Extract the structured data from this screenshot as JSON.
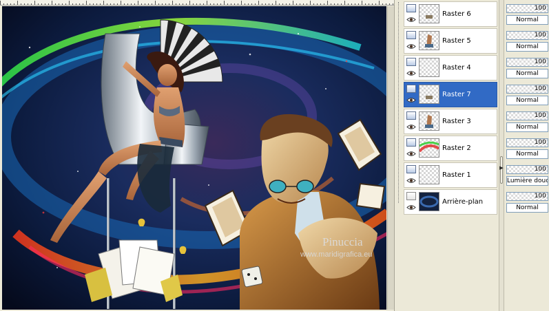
{
  "canvas": {
    "watermark_name": "Pinuccia",
    "watermark_url": "www.maridigrafica.eu"
  },
  "layers": [
    {
      "name": "Raster 6",
      "opacity": "100",
      "opacity_level": 1.0,
      "blend": "Normal",
      "selected": false,
      "type_icon": "raster-layer-icon",
      "thumb": "transparent-with-small-object"
    },
    {
      "name": "Raster 5",
      "opacity": "100",
      "opacity_level": 1.0,
      "blend": "Normal",
      "selected": false,
      "type_icon": "raster-layer-icon",
      "thumb": "transparent-with-figure"
    },
    {
      "name": "Raster 4",
      "opacity": "100",
      "opacity_level": 1.0,
      "blend": "Normal",
      "selected": false,
      "type_icon": "raster-layer-icon",
      "thumb": "transparent"
    },
    {
      "name": "Raster 7",
      "opacity": "100",
      "opacity_level": 1.0,
      "blend": "Normal",
      "selected": true,
      "type_icon": "raster-layer-icon",
      "thumb": "transparent-with-small-object"
    },
    {
      "name": "Raster 3",
      "opacity": "100",
      "opacity_level": 1.0,
      "blend": "Normal",
      "selected": false,
      "type_icon": "raster-layer-icon",
      "thumb": "transparent-with-figure"
    },
    {
      "name": "Raster 2",
      "opacity": "100",
      "opacity_level": 1.0,
      "blend": "Normal",
      "selected": false,
      "type_icon": "raster-layer-icon",
      "thumb": "colorful-swirl"
    },
    {
      "name": "Raster 1",
      "opacity": "100",
      "opacity_level": 1.0,
      "blend": "Lumière douce",
      "selected": false,
      "type_icon": "raster-layer-icon",
      "thumb": "transparent"
    },
    {
      "name": "Arrière-plan",
      "opacity": "100",
      "opacity_level": 1.0,
      "blend": "Normal",
      "selected": false,
      "type_icon": "background-layer-icon",
      "thumb": "dark-background"
    }
  ],
  "colors": {
    "selection": "#316ac5",
    "panel": "#ece9d8"
  }
}
